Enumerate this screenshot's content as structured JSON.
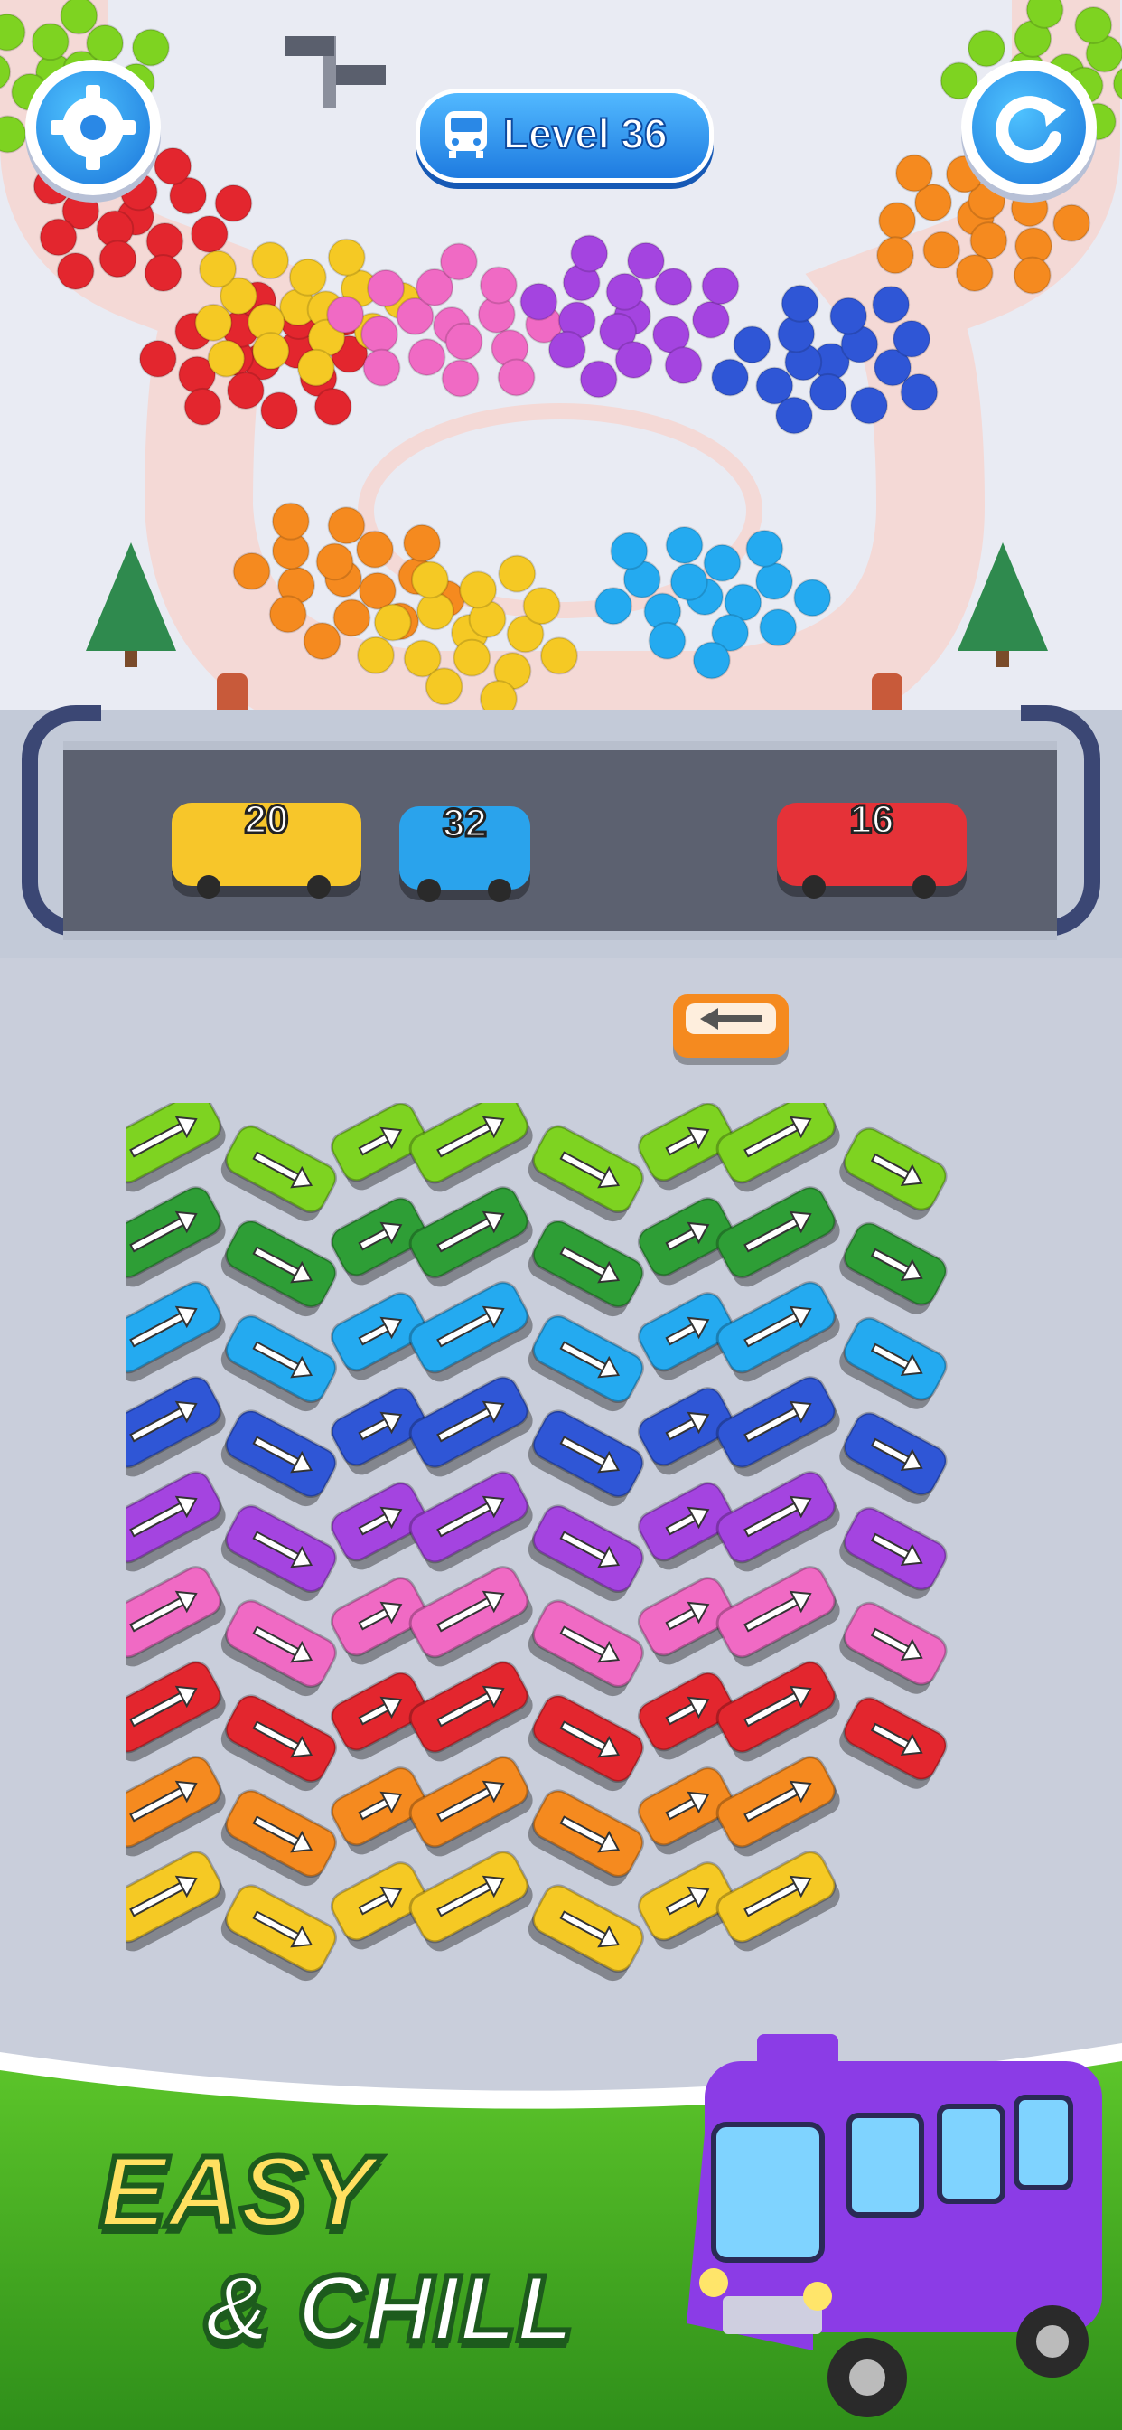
{
  "hud": {
    "settings_icon": "gear-icon",
    "restart_icon": "restart-arrow-icon",
    "level_icon": "bus-icon",
    "level_label": "Level 36"
  },
  "parking_lane": {
    "slots": [
      {
        "color": "#f7c62a",
        "capacity": "20",
        "kind": "bus"
      },
      {
        "color": "#2aa3ec",
        "capacity": "32",
        "kind": "car"
      },
      {
        "color": "#e53238",
        "capacity": "16",
        "kind": "bus"
      }
    ]
  },
  "incoming_vehicle": {
    "color": "#f58a1f",
    "direction": "left"
  },
  "vehicle_grid": {
    "rows": [
      {
        "color": "#7ed321"
      },
      {
        "color": "#2e9e36"
      },
      {
        "color": "#24aaf0"
      },
      {
        "color": "#2f56d6"
      },
      {
        "color": "#a444e0"
      },
      {
        "color": "#f06ac4"
      },
      {
        "color": "#e3262e"
      },
      {
        "color": "#f58a1f"
      },
      {
        "color": "#f5c924"
      }
    ]
  },
  "crowd_colors": [
    "#e3262e",
    "#f5c924",
    "#f06ac4",
    "#a444e0",
    "#f58a1f",
    "#2f56d6",
    "#24aaf0",
    "#7ed321"
  ],
  "banner": {
    "line1": "EASY",
    "line2": "& CHILL",
    "mascot_color": "#8b3ce6"
  }
}
